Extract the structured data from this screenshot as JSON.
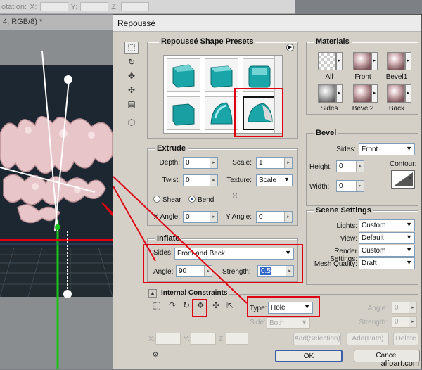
{
  "background_app": {
    "toolbar_label": "otation:",
    "field_x_label": "X:",
    "field_y_label": "Y:",
    "field_z_label": "Z:",
    "doc_tab": "4, RGB/8) *"
  },
  "dialog": {
    "title": "Repoussé",
    "presets": {
      "title": "Repoussé Shape Presets",
      "count": 6
    },
    "materials": {
      "title": "Materials",
      "items": [
        {
          "label": "All",
          "icon": "checker-material-icon"
        },
        {
          "label": "Front",
          "icon": "sphere-material-icon"
        },
        {
          "label": "Bevel1",
          "icon": "sphere-material-icon"
        },
        {
          "label": "Sides",
          "icon": "grey-sphere-material-icon"
        },
        {
          "label": "Bevel2",
          "icon": "sphere-material-icon"
        },
        {
          "label": "Back",
          "icon": "sphere-material-icon"
        }
      ]
    },
    "extrude": {
      "title": "Extrude",
      "depth_label": "Depth:",
      "depth_value": "0",
      "scale_label": "Scale:",
      "scale_value": "1",
      "twist_label": "Twist:",
      "twist_value": "0",
      "texture_label": "Texture:",
      "texture_value": "Scale",
      "shear_label": "Shear",
      "bend_label": "Bend",
      "xangle_label": "X Angle:",
      "xangle_value": "0",
      "yangle_label": "Y Angle:",
      "yangle_value": "0"
    },
    "bevel": {
      "title": "Bevel",
      "sides_label": "Sides:",
      "sides_value": "Front",
      "height_label": "Height:",
      "height_value": "0",
      "contour_label": "Contour:",
      "width_label": "Width:",
      "width_value": "0"
    },
    "inflate": {
      "title": "Inflate",
      "sides_label": "Sides:",
      "sides_value": "Front and Back",
      "angle_label": "Angle:",
      "angle_value": "90",
      "strength_label": "Strength:",
      "strength_value": "0.5"
    },
    "scene": {
      "title": "Scene Settings",
      "lights_label": "Lights:",
      "lights_value": "Custom",
      "view_label": "View:",
      "view_value": "Default",
      "render_label": "Render Settings:",
      "render_value": "Custom",
      "mesh_label": "Mesh Quality:",
      "mesh_value": "Draft"
    },
    "constraints": {
      "title": "Internal Constraints",
      "type_label": "Type:",
      "type_value": "Hole",
      "side_label": "Side:",
      "side_value": "Both",
      "angle_label": "Angle:",
      "angle_value": "0",
      "strength_label": "Strength:",
      "strength_value": "0",
      "x_label": "X:",
      "y_label": "Y:",
      "z_label": "Z:",
      "add_selection": "Add(Selection)",
      "add_path": "Add(Path)",
      "delete": "Delete"
    },
    "ok": "OK",
    "cancel": "Cancel"
  },
  "watermark": "alfoart.com",
  "colors": {
    "highlight": "#e00012",
    "preset_teal": "#1aa5a8",
    "dialog_bg": "#d4d0c8"
  }
}
